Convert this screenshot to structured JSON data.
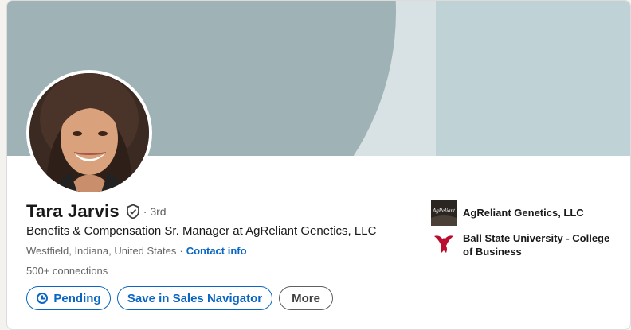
{
  "profile": {
    "name": "Tara Jarvis",
    "degree": "· 3rd",
    "headline": "Benefits & Compensation Sr. Manager at AgReliant Genetics, LLC",
    "location": "Westfield, Indiana, United States",
    "location_separator": "·",
    "contact_info": "Contact info",
    "connections": "500+ connections"
  },
  "actions": {
    "pending": "Pending",
    "save_sales_navigator": "Save in Sales Navigator",
    "more": "More"
  },
  "organizations": [
    {
      "name": "AgReliant Genetics, LLC",
      "logo_text": "AgReliant",
      "icon": "agreliant-logo-icon"
    },
    {
      "name": "Ball State University - College of Business",
      "icon": "ball-state-logo-icon"
    }
  ],
  "colors": {
    "accent": "#0a66c2",
    "banner_light": "#bfd2d5",
    "banner_mid": "#d8e2e4",
    "banner_dark": "#9fb2b5",
    "ball_state_red": "#ba0c2f"
  }
}
